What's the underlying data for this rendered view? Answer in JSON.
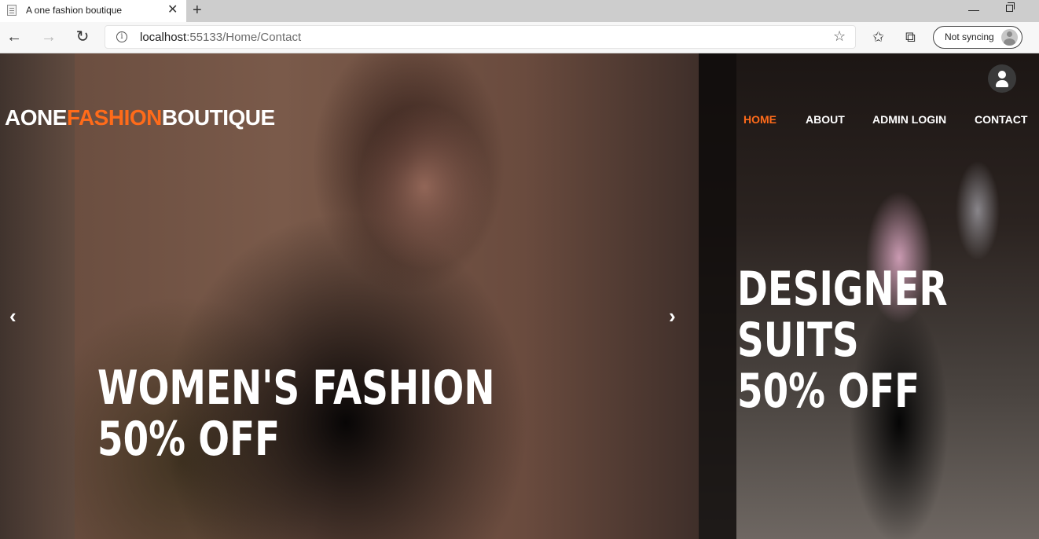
{
  "browser": {
    "tab_title": "A one fashion boutique",
    "new_tab_symbol": "+",
    "close_symbol": "✕",
    "url_host": "localhost",
    "url_rest": ":55133/Home/Contact",
    "sync_label": "Not syncing"
  },
  "header": {
    "brand_part1": "AONE",
    "brand_part2": "FASHION",
    "brand_part3": "BOUTIQUE",
    "accent_color": "#ff6b1a",
    "nav": [
      {
        "label": "HOME",
        "active": true
      },
      {
        "label": "ABOUT",
        "active": false
      },
      {
        "label": "ADMIN LOGIN",
        "active": false
      },
      {
        "label": "CONTACT",
        "active": false
      }
    ]
  },
  "carousel": {
    "slide1": {
      "line1": "WOMEN'S FASHION",
      "line2": "50% OFF"
    },
    "slide2": {
      "line1": "DESIGNER",
      "line2": "SUITS",
      "line3": "50% OFF"
    },
    "prev_symbol": "‹",
    "next_symbol": "›"
  }
}
